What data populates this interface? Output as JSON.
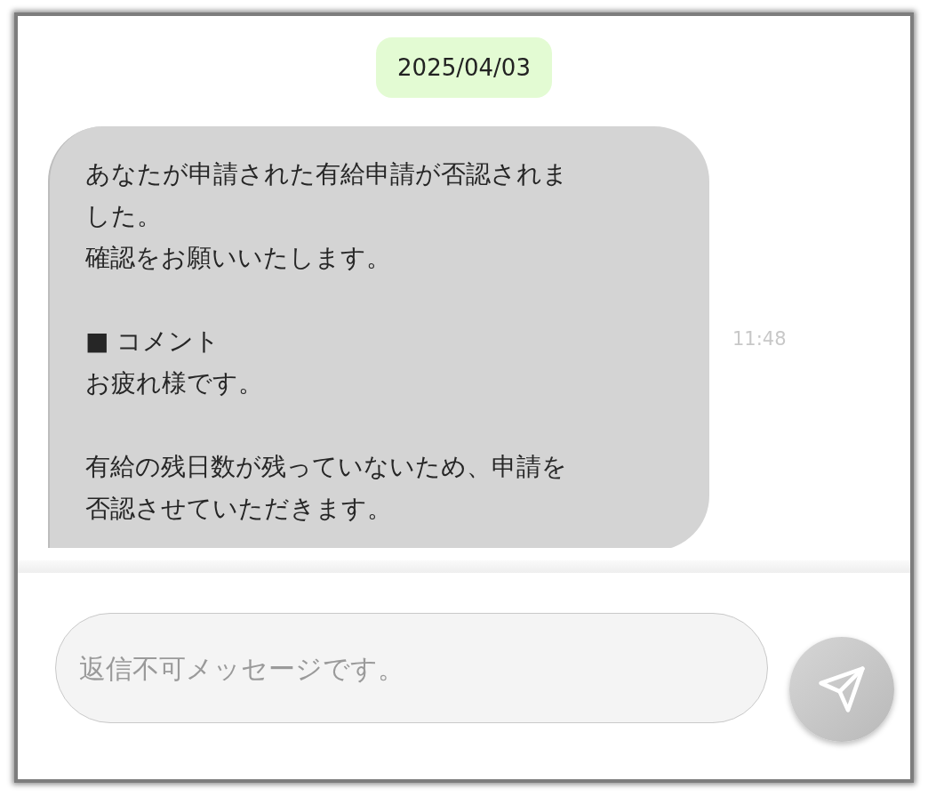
{
  "date_badge": "2025/04/03",
  "messages": [
    {
      "paragraphs": [
        [
          "あなたが申請された有給申請が否認されました。",
          "確認をお願いいたします。"
        ],
        [
          "■ コメント",
          "お疲れ様です。"
        ],
        [
          "有給の残日数が残っていないため、申請を否認させていただきます。"
        ]
      ],
      "time": "11:48"
    }
  ],
  "composer": {
    "placeholder": "返信不可メッセージです。"
  }
}
